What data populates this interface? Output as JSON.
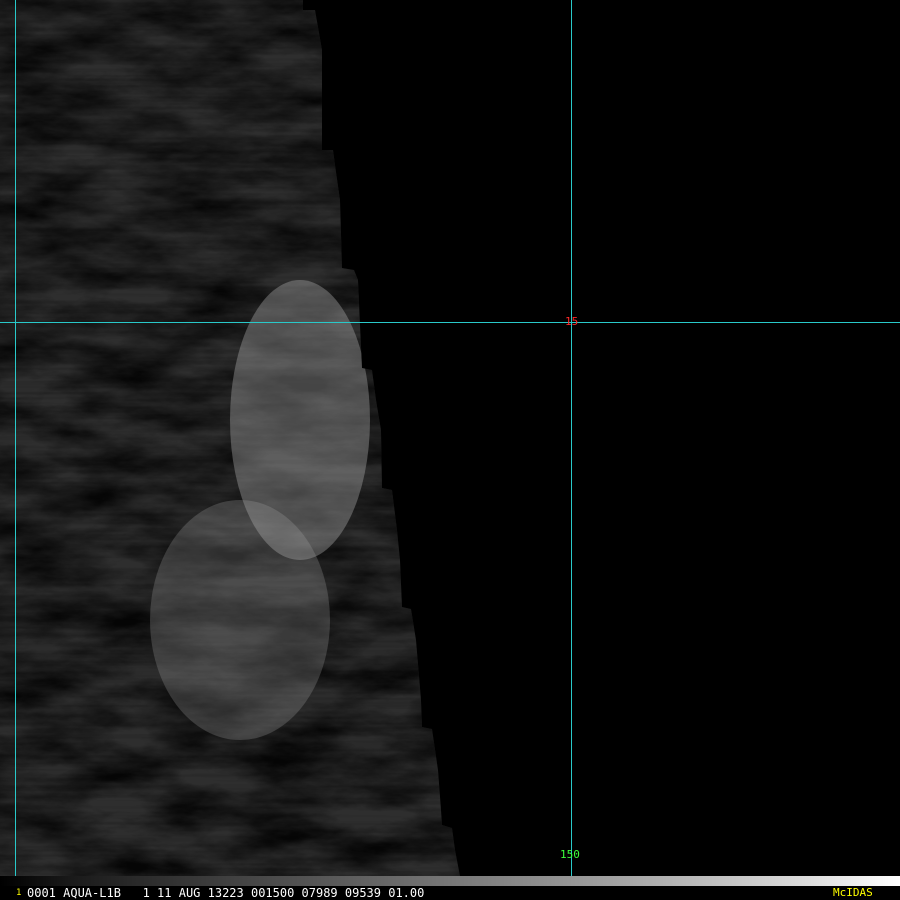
{
  "overlay": {
    "lat_label": "15",
    "lon_label": "150",
    "line_color": "#29c9c9",
    "lat_label_color": "#ff2a2a",
    "lon_label_color": "#3cff3c"
  },
  "status_bar": {
    "frame_number": "1",
    "frame_number_color": "#ffff00",
    "info_text": "0001 AQUA-L1B   1 11 AUG 13223 001500 07989 09539 01.00",
    "brand": "McIDAS",
    "brand_color": "#ffff00"
  }
}
